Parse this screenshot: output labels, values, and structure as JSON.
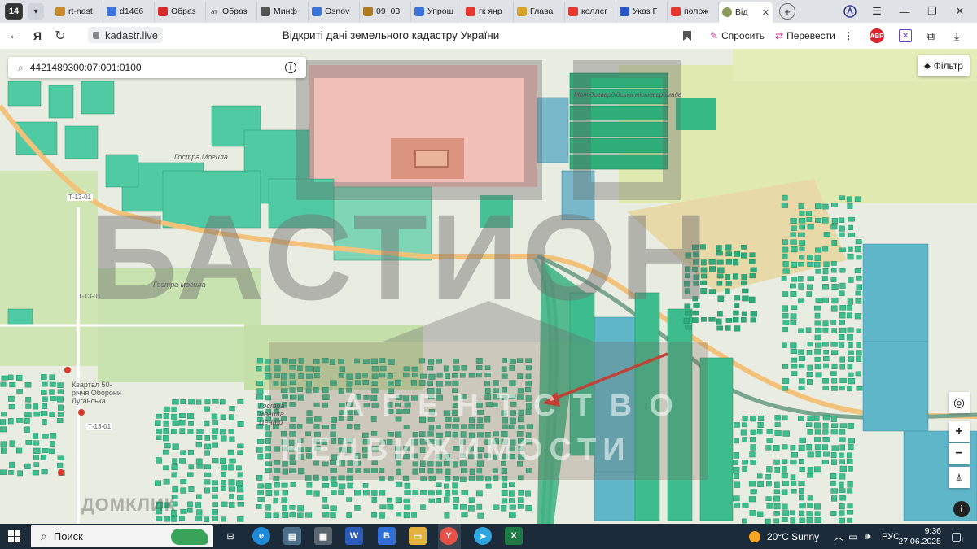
{
  "browser": {
    "tab_count": "14",
    "tabs": [
      {
        "label": "rt-nast",
        "color": "#c88a2a"
      },
      {
        "label": "d1466",
        "color": "#3b73d8"
      },
      {
        "label": "Образ",
        "color": "#d42b2b"
      },
      {
        "label": "Образ",
        "color": "#444444",
        "prefix": "ат"
      },
      {
        "label": "Минф",
        "color": "#555555"
      },
      {
        "label": "Osnov",
        "color": "#3b73d8"
      },
      {
        "label": "09_03",
        "color": "#b07a22"
      },
      {
        "label": "Упрощ",
        "color": "#3b73d8"
      },
      {
        "label": "гк янр",
        "color": "#e5372e"
      },
      {
        "label": "Глава",
        "color": "#d8a22a"
      },
      {
        "label": "коллег",
        "color": "#e5372e"
      },
      {
        "label": "Указ Г",
        "color": "#2a57c4"
      },
      {
        "label": "полож",
        "color": "#e5372e"
      }
    ],
    "active_tab": {
      "label": "Від",
      "close": "✕"
    },
    "url": "kadastr.live",
    "page_title": "Відкриті дані земельного кадастру України",
    "ask_label": "Спросить",
    "translate_label": "Перевести",
    "abp_label": "ABP"
  },
  "map": {
    "search_value": "4421489300:07:001:0100",
    "filter_label": "Фільтр",
    "labels": {
      "gostra_1": "Гостра Могила",
      "gostra_2": "Гостра могила",
      "gostra_3": "Гостра могила Центр",
      "kvartal": "Квартал 50-річчя Оборони Луганська",
      "road_1": "Т-13-01",
      "road_2": "Т-13-01",
      "road_3": "Т-13-01",
      "komun": "Молодогвардійська міська громада"
    },
    "watermark": {
      "big": "БАСТИОН",
      "line1": "АГЕНТСТВО",
      "line2": "НЕДВИЖИМОСТИ",
      "corner": "ДОМКЛИК"
    },
    "colors": {
      "parcel_green": "#3fbf8f",
      "parcel_dark": "#1f9a6c",
      "parcel_blue": "#6fb7c7",
      "industrial_pink": "#f0a8a8",
      "farmland": "#d8e8a8",
      "road": "#f3c27a"
    }
  },
  "taskbar": {
    "search_placeholder": "Поиск",
    "weather": "20°C  Sunny",
    "language": "РУС",
    "time": "9:36",
    "date": "27.06.2025",
    "notifications": "1"
  }
}
